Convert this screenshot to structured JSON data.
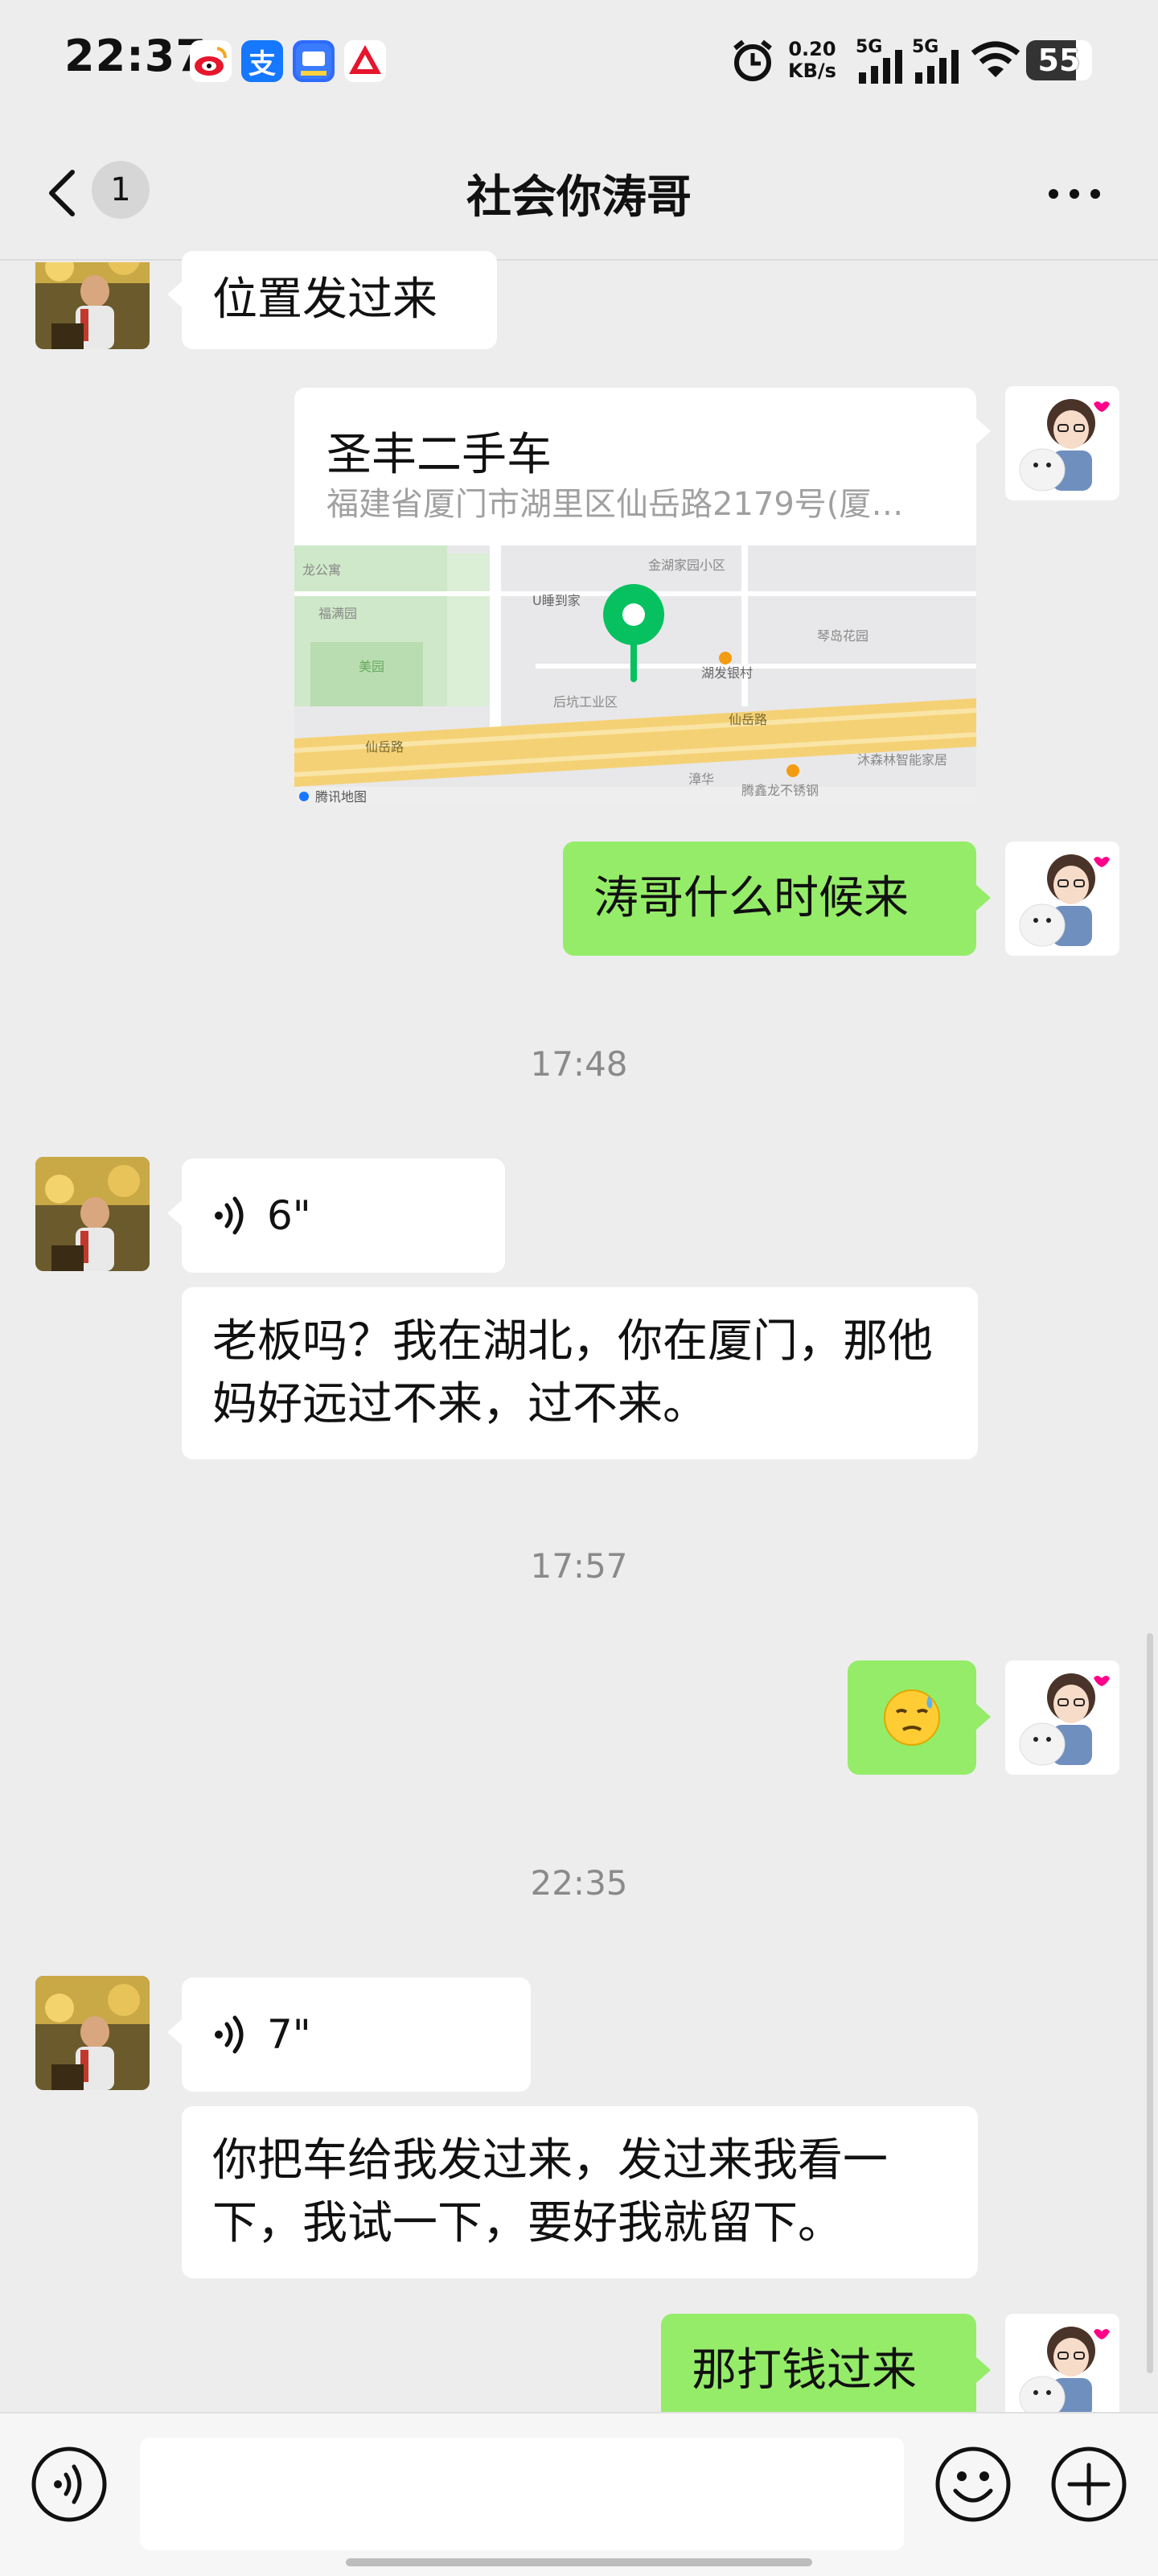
{
  "status_bar": {
    "time": "22:37",
    "app_icons": [
      "weibo-icon",
      "alipay-icon",
      "app-icon-3",
      "app-icon-4"
    ],
    "net_speed": "0.20",
    "net_unit": "KB/s",
    "sim1": "5G",
    "sim2": "5G",
    "battery": "55",
    "battery_level": 0.76
  },
  "nav": {
    "unread_count": "1",
    "title": "社会你涛哥"
  },
  "messages": {
    "m1": "位置发过来",
    "location": {
      "name": "圣丰二手车",
      "address": "福建省厦门市湖里区仙岳路2179号(厦…",
      "map_labels": [
        "金湖家园小区",
        "U睡到家",
        "湖发银村",
        "琴岛花园",
        "后坑工业区",
        "仙岳路",
        "仙岳路",
        "漳华",
        "腾鑫龙不锈钢",
        "沐森林智能家居",
        "腾讯地图",
        "福满园",
        "美园",
        "龙公寓"
      ]
    },
    "m2": "涛哥什么时候来",
    "ts1": "17:48",
    "voice1": "6\"",
    "m3": "老板吗？我在湖北，你在厦门，那他妈好远过不来，过不来。",
    "ts2": "17:57",
    "ts3": "22:35",
    "voice2": "7\"",
    "m4": "你把车给我发过来，发过来我看一下，我试一下，要好我就留下。",
    "m5": "那打钱过来"
  },
  "input": {
    "placeholder": ""
  },
  "colors": {
    "background": "#ededed",
    "outgoing_bubble": "#95ec69",
    "incoming_bubble": "#ffffff",
    "map_pin": "#07c160"
  }
}
